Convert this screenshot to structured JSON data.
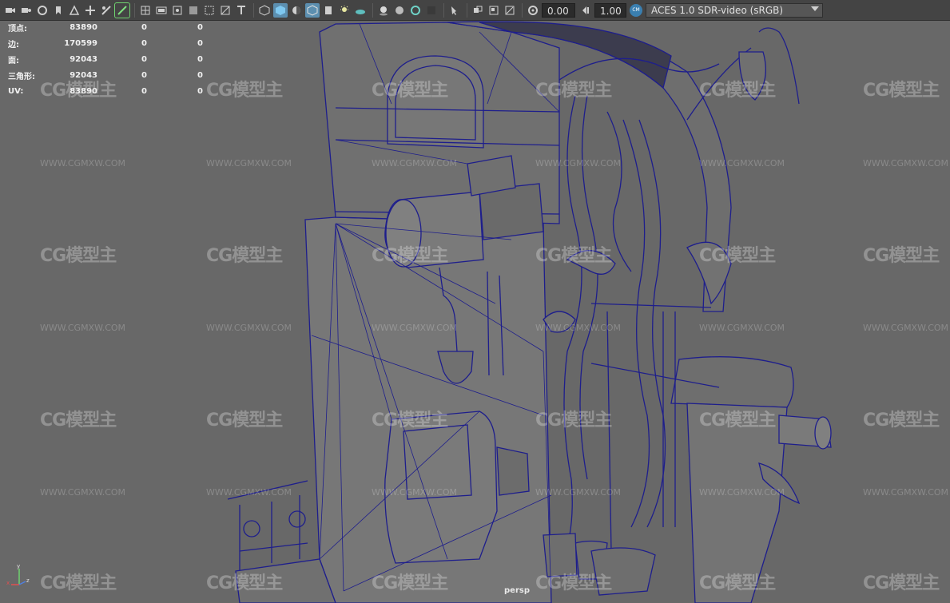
{
  "toolbar": {
    "icons": [
      "camera-icon",
      "camera-attributes-icon",
      "bookmark-icon",
      "image-plane-icon",
      "grid-icon",
      "film-gate-icon",
      "resolution-gate-icon",
      "gate-mask-icon",
      "field-chart-icon",
      "safe-action-icon",
      "safe-title-icon",
      "wireframe-icon",
      "smooth-shade-icon",
      "use-default-material-icon",
      "wireframe-on-shaded-icon",
      "xray-icon",
      "xray-joints-icon",
      "lights-icon",
      "shadows-icon",
      "screen-space-ao-icon",
      "motion-blur-icon",
      "anti-aliasing-icon",
      "depth-of-field-icon",
      "isolate-select-icon",
      "xray-active-icon",
      "textured-icon",
      "backface-cull-icon",
      "exposure-icon",
      "gamma-icon",
      "color-management-icon"
    ],
    "exposure_value": "0.00",
    "gamma_value": "1.00",
    "color_space": "ACES 1.0 SDR-video (sRGB)",
    "accent_color": "#5c8fb0"
  },
  "hud": {
    "rows": [
      {
        "label": "顶点:",
        "v1": "83890",
        "v2": "0",
        "v3": "0"
      },
      {
        "label": "边:",
        "v1": "170599",
        "v2": "0",
        "v3": "0"
      },
      {
        "label": "面:",
        "v1": "92043",
        "v2": "0",
        "v3": "0"
      },
      {
        "label": "三角形:",
        "v1": "92043",
        "v2": "0",
        "v3": "0"
      },
      {
        "label": "UV:",
        "v1": "83890",
        "v2": "0",
        "v3": "0"
      }
    ]
  },
  "viewport": {
    "camera_label": "persp",
    "wire_color": "#1e1e8c",
    "background_color": "#686868"
  },
  "axis": {
    "x": "x",
    "y": "y",
    "z": "z"
  },
  "watermark": {
    "logo_text": "CG模型主",
    "url_text": "WWW.CGMXW.COM"
  }
}
